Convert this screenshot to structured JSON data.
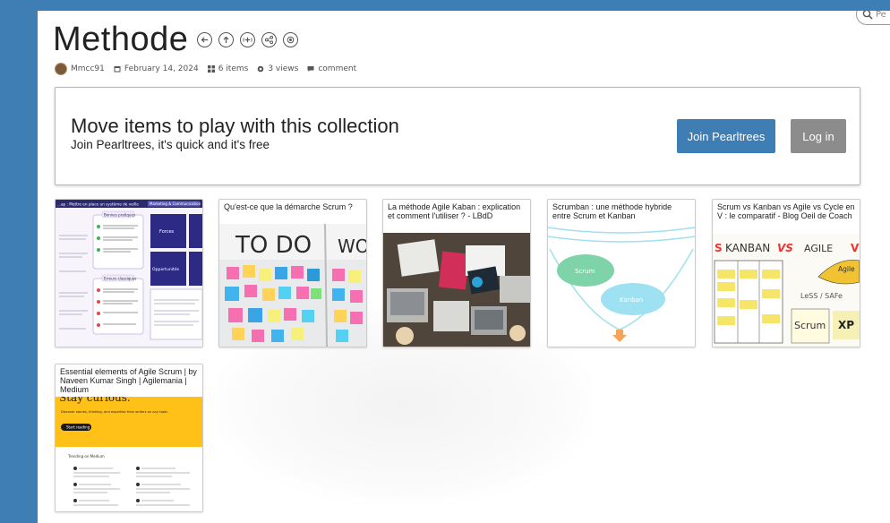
{
  "search": {
    "placeholder": "Pe"
  },
  "header": {
    "title": "Methode",
    "icons": [
      "back-icon",
      "up-icon",
      "add-icon",
      "share-icon",
      "target-icon"
    ]
  },
  "meta": {
    "author": "Mmcc91",
    "date": "February 14, 2024",
    "items": "6 items",
    "views": "3 views",
    "comment": "comment"
  },
  "join_box": {
    "headline": "Move items to play with this collection",
    "subline": "Join Pearltrees, it's quick and it's free",
    "join_label": "Join Pearltrees",
    "login_label": "Log in",
    "join_color": "#3f7eb5",
    "login_color": "#8c8c8c"
  },
  "cards": [
    {
      "caption": "",
      "thumb": {
        "header_left": "...ap : Mettre en place un système de veille",
        "header_right": "Marketing & Communication",
        "box1": "Bonnes pratiques",
        "box2": "Erreurs classiques",
        "tile1": "Forces",
        "tile2": "Opportunités"
      }
    },
    {
      "caption": "Qu'est-ce que la démarche Scrum ?",
      "thumb": {
        "board_left": "TO DO",
        "board_right": "WOR"
      }
    },
    {
      "caption": "La méthode Agile Kaban : explication et comment l'utiliser ? - LBdD"
    },
    {
      "caption": "Scrumban : une méthode hybride entre Scrum et Kanban",
      "thumb": {
        "scrum": "Scrum",
        "kanban": "Kanban"
      }
    },
    {
      "caption": "Scrum vs Kanban vs Agile vs Cycle en V : le comparatif - Blog Oeil de Coach",
      "thumb": {
        "kanban": "KANBAN",
        "vs": "VS",
        "agile": "AGILE",
        "agile_small": "Agile",
        "lss": "LeSS / SAFe",
        "scrum": "Scrum",
        "xp": "XP"
      }
    },
    {
      "caption": "Essential elements of Agile Scrum | by Naveen Kumar Singh | Agilemania | Medium",
      "thumb": {
        "banner": "Stay curious.",
        "subtitle": "Discover stories, thinking, and expertise from writers on any topic.",
        "cta": "Start reading",
        "trending": "Trending on Medium"
      }
    }
  ]
}
